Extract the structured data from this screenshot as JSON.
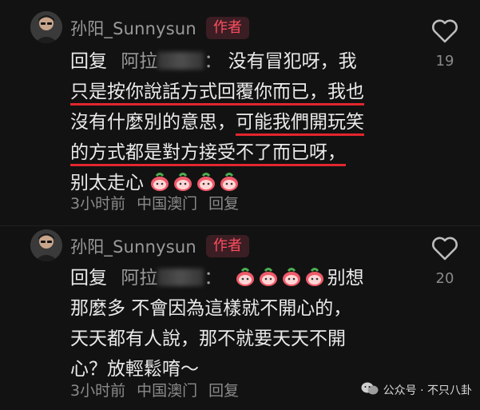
{
  "comments": [
    {
      "username": "孙阳_Sunnysun",
      "badge": "作者",
      "reply_prefix": "回复",
      "reply_to": "阿拉",
      "reply_suffix": "：",
      "lines": [
        {
          "a": "没有冒犯呀，我"
        },
        {
          "a": "只是按你說話方式回覆你而已，我也"
        },
        {
          "a": "沒有什麼別的意思，",
          "b": "可能我們開玩笑"
        },
        {
          "a": "的方式都是對方接受不了而已呀，"
        },
        {
          "a": "别太走心"
        }
      ],
      "meta": {
        "time": "3小时前",
        "location": "中国澳门",
        "reply_label": "回复"
      },
      "likes": "19"
    },
    {
      "username": "孙阳_Sunnysun",
      "badge": "作者",
      "reply_prefix": "回复",
      "reply_to": "阿拉",
      "reply_suffix": "：",
      "lines": [
        {
          "a": "别想"
        },
        {
          "a": "那麼多 不會因為這樣就不開心的，"
        },
        {
          "a": "天天都有人說，那不就要天天不開"
        },
        {
          "a": "心？放輕鬆唷～"
        }
      ],
      "meta": {
        "time": "3小时前",
        "location": "中国澳门",
        "reply_label": "回复"
      },
      "likes": "20"
    }
  ],
  "watermark": "公众号 · 不只八卦",
  "colors": {
    "background": "#121212",
    "accent": "#e2262e",
    "badge_text": "#ff4d5e"
  },
  "icons": {
    "like": "heart-outline-icon",
    "emoji": "peach-face-emoji-icon",
    "watermark": "wechat-icon"
  }
}
